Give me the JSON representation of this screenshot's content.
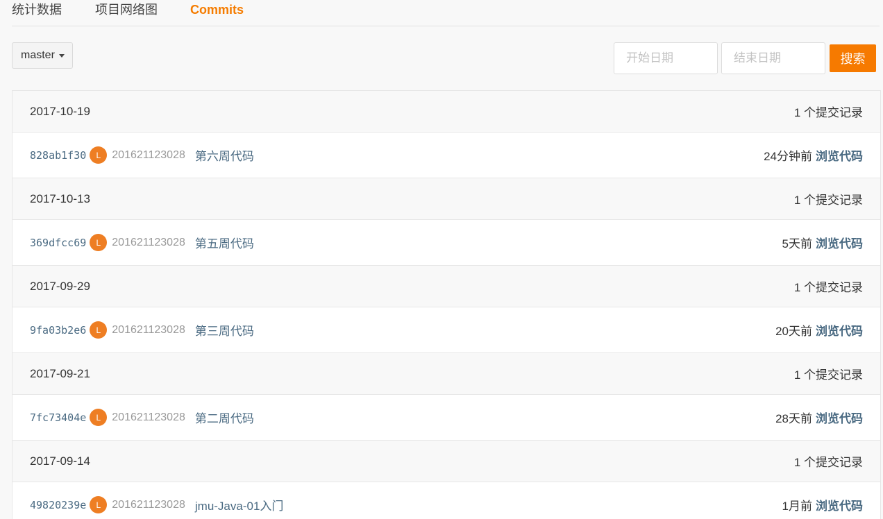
{
  "tabs": [
    {
      "label": "统计数据",
      "active": false
    },
    {
      "label": "项目网络图",
      "active": false
    },
    {
      "label": "Commits",
      "active": true
    }
  ],
  "toolbar": {
    "branch": "master",
    "start_placeholder": "开始日期",
    "end_placeholder": "结束日期",
    "search_label": "搜索"
  },
  "groups": [
    {
      "date": "2017-10-19",
      "count": "1 个提交记录",
      "commits": [
        {
          "sha": "828ab1f30",
          "avatar": "L",
          "author": "201621123028",
          "message": "第六周代码",
          "time": "24分钟前",
          "browse": "浏览代码"
        }
      ]
    },
    {
      "date": "2017-10-13",
      "count": "1 个提交记录",
      "commits": [
        {
          "sha": "369dfcc69",
          "avatar": "L",
          "author": "201621123028",
          "message": "第五周代码",
          "time": "5天前",
          "browse": "浏览代码"
        }
      ]
    },
    {
      "date": "2017-09-29",
      "count": "1 个提交记录",
      "commits": [
        {
          "sha": "9fa03b2e6",
          "avatar": "L",
          "author": "201621123028",
          "message": "第三周代码",
          "time": "20天前",
          "browse": "浏览代码"
        }
      ]
    },
    {
      "date": "2017-09-21",
      "count": "1 个提交记录",
      "commits": [
        {
          "sha": "7fc73404e",
          "avatar": "L",
          "author": "201621123028",
          "message": "第二周代码",
          "time": "28天前",
          "browse": "浏览代码"
        }
      ]
    },
    {
      "date": "2017-09-14",
      "count": "1 个提交记录",
      "commits": [
        {
          "sha": "49820239e",
          "avatar": "L",
          "author": "201621123028",
          "message": "jmu-Java-01入门",
          "time": "1月前",
          "browse": "浏览代码"
        }
      ]
    }
  ],
  "colors": {
    "accent": "#f67a00",
    "link": "#4a6a82",
    "avatar": "#ee7e23"
  }
}
